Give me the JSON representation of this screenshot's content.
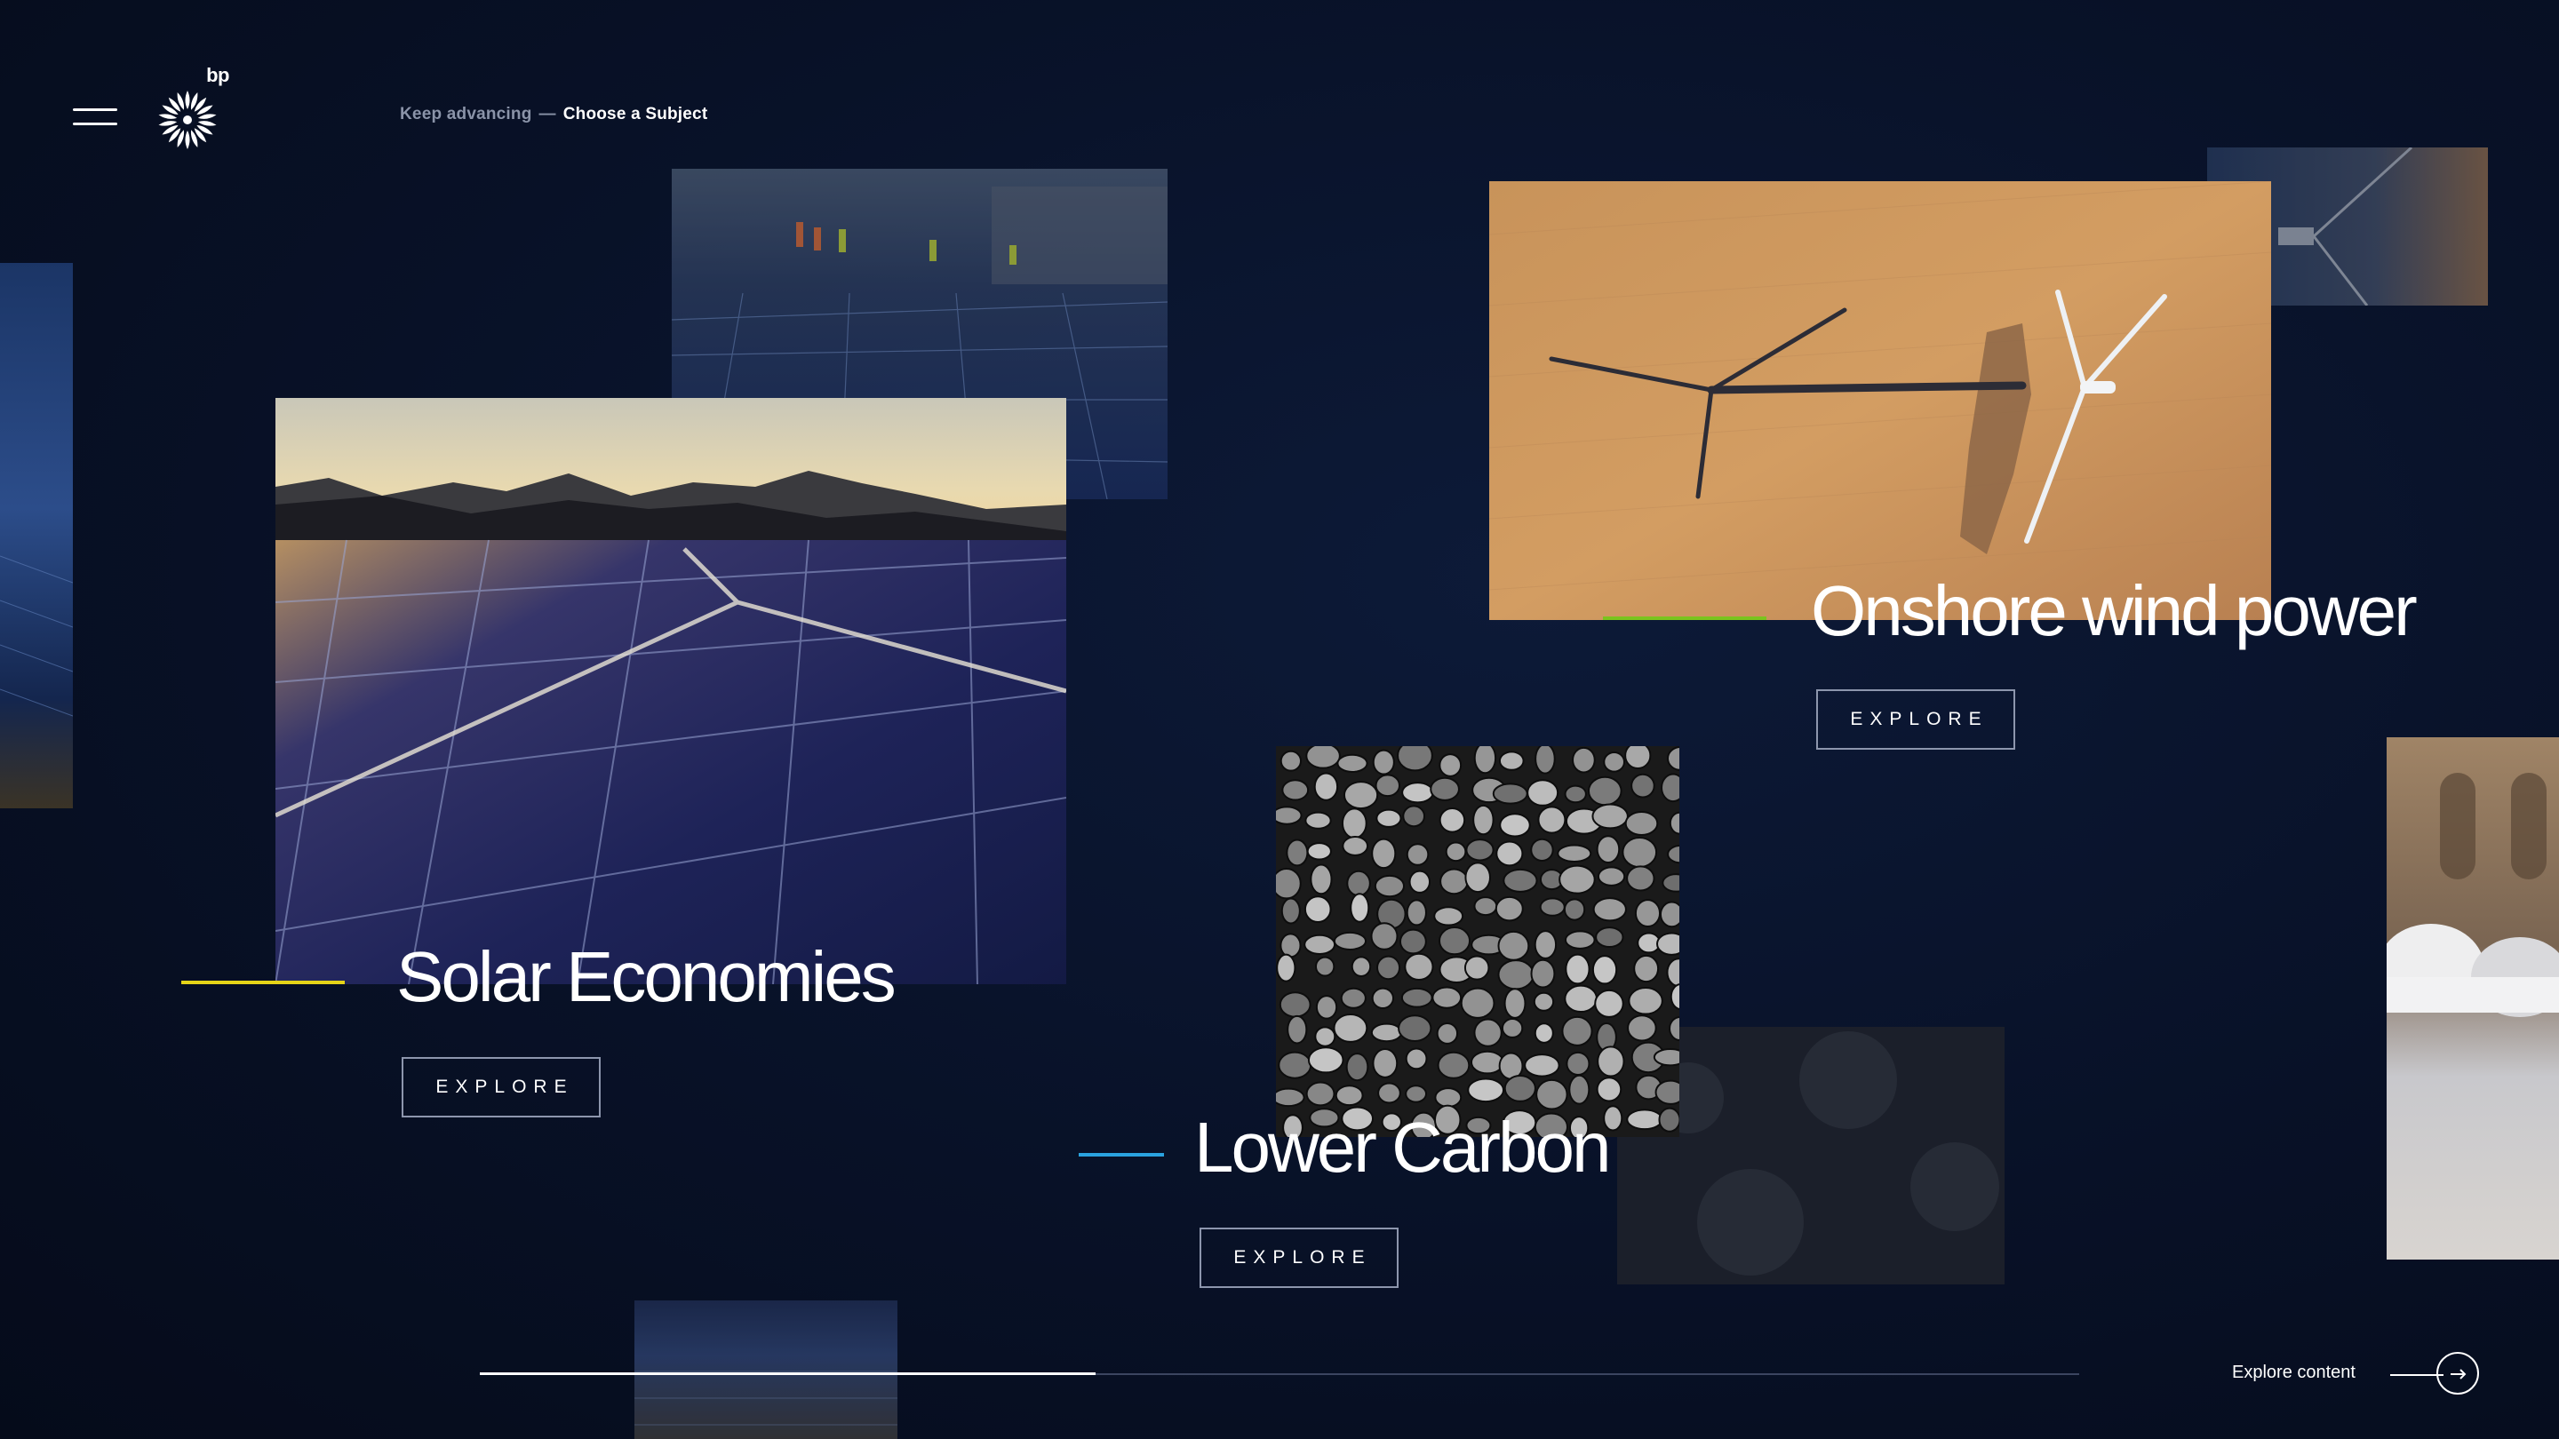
{
  "header": {
    "breadcrumb": {
      "parent": "Keep advancing",
      "separator": "—",
      "current": "Choose a Subject"
    },
    "logo_text": "bp",
    "menu_icon": "hamburger-icon"
  },
  "subjects": [
    {
      "title": "Solar Economies",
      "button": "EXPLORE",
      "accent_color": "#e5d418"
    },
    {
      "title": "Onshore wind power",
      "button": "EXPLORE",
      "accent_color": "#7ac41e"
    },
    {
      "title": "Lower Carbon",
      "button": "EXPLORE",
      "accent_color": "#2aa3e0"
    }
  ],
  "footer": {
    "explore_content_label": "Explore content",
    "progress": 0.385,
    "arrow_icon": "arrow-right-circle-icon"
  },
  "colors": {
    "background": "#081127",
    "button_border": "#8d96ad"
  }
}
